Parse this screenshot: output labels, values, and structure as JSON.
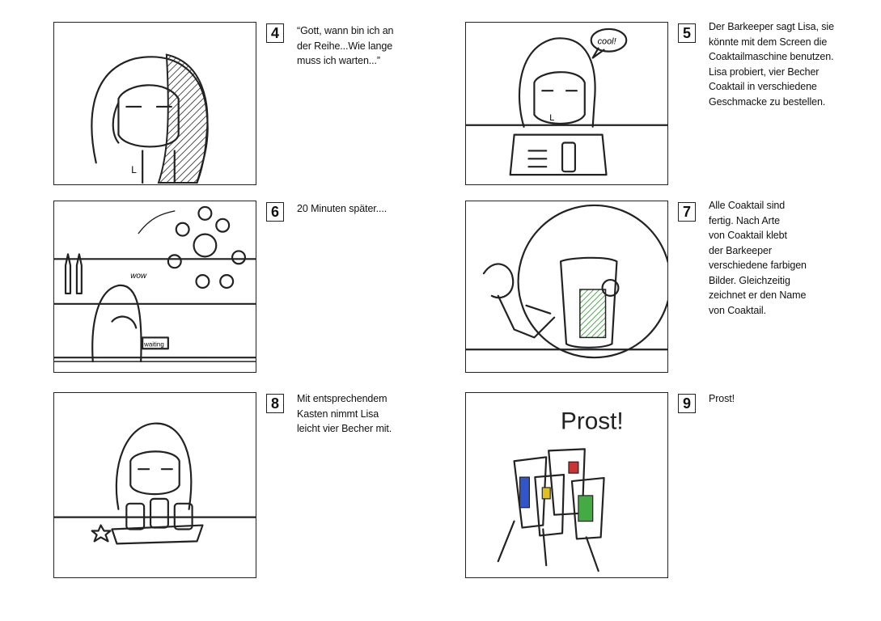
{
  "frames": [
    {
      "number": "4",
      "caption": "“Gott, wann bin ich an\nder Reihe...Wie lange\nmuss ich warten...”",
      "drawing": "girl-waiting"
    },
    {
      "number": "5",
      "caption": "Der Barkeeper sagt Lisa, sie\nkönnte mit dem Screen die\nCoaktailmaschine benutzen.\nLisa probiert, vier Becher\nCoaktail in verschiedene\nGeschmacke zu bestellen.",
      "drawing": "girl-at-screen"
    },
    {
      "number": "6",
      "caption": "20 Minuten später....",
      "drawing": "waiting-at-bar"
    },
    {
      "number": "7",
      "caption": "Alle Coaktail sind\nfertig. Nach Arte\nvon Coaktail klebt\nder Barkeeper\nverschiedene farbigen\nBilder. Gleichzeitig\nzeichnet er den Name\nvon Coaktail.",
      "drawing": "barkeeper-labeling"
    },
    {
      "number": "8",
      "caption": "Mit entsprechendem\nKasten nimmt Lisa\nleicht vier Becher mit.",
      "drawing": "girl-with-tray"
    },
    {
      "number": "9",
      "caption": "Prost!",
      "drawing": "toast"
    }
  ],
  "sketch_text": {
    "bubble": "cool!",
    "wow": "wow",
    "sign": "waiting",
    "prost": "Prost!",
    "initial": "L"
  },
  "colors": {
    "ink": "#222222",
    "hatch_green": "#3a9a3a",
    "cup_blue": "#3355cc",
    "cup_red": "#cc3333",
    "cup_yellow": "#e0c020",
    "cup_green": "#44aa44"
  }
}
